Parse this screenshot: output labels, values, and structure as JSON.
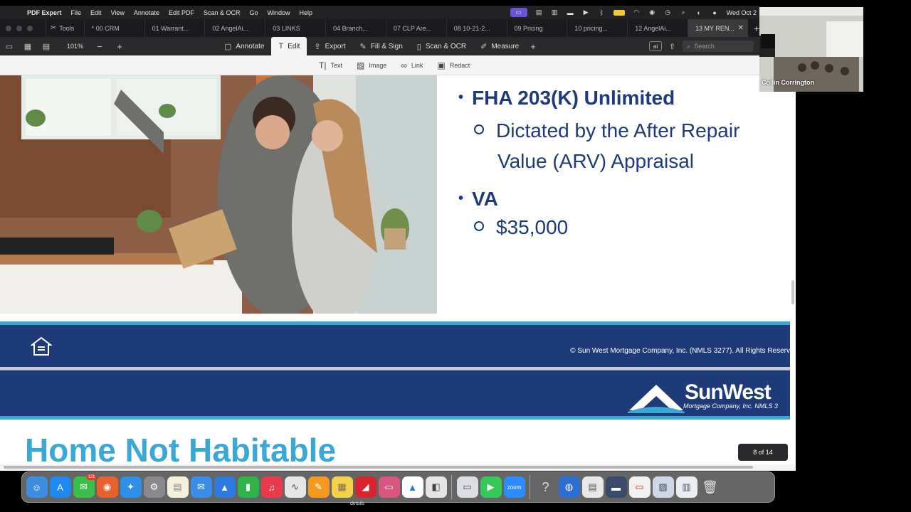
{
  "menubar": {
    "app_name": "PDF Expert",
    "menus": [
      "File",
      "Edit",
      "View",
      "Annotate",
      "Edit PDF",
      "Scan & OCR",
      "Go",
      "Window",
      "Help"
    ],
    "clock": "Wed Oct 2"
  },
  "tabs": {
    "tools_label": "Tools",
    "items": [
      "* 00 CRM",
      "01 Warrant...",
      "02 AngelAi...",
      "03 LINKS",
      "04 Branch...",
      "07 CLP Are...",
      "08 10-21-2...",
      "09 Pricing",
      "10 pricing...",
      "12 AngelAi...",
      "13 MY REN..."
    ],
    "active_index": 10
  },
  "toolbar": {
    "zoom": "101%",
    "modes": [
      "Annotate",
      "Edit",
      "Export",
      "Fill & Sign",
      "Scan & OCR",
      "Measure"
    ],
    "active_mode": "Edit",
    "ai_label": "ai",
    "search_placeholder": "Search"
  },
  "edit_tools": [
    "Text",
    "Image",
    "Link",
    "Redact"
  ],
  "document": {
    "bullet1": "FHA 203(K) Unlimited",
    "sub1_line1": "Dictated by the After Repair",
    "sub1_line2": "Value (ARV) Appraisal",
    "bullet2": "VA",
    "sub2": "$35,000",
    "copyright": "© Sun West Mortgage Company, Inc. (NMLS 3277). All Rights Reserv",
    "logo_main": "SunWest",
    "logo_sub": "Mortgage Company, Inc. NMLS 3",
    "heading": "Home Not Habitable",
    "page_indicator": "8 of 14"
  },
  "video": {
    "name": "Collin Corrington"
  },
  "dock": {
    "messages_badge": "121",
    "zoom_label": "zoom",
    "tooltip": "details"
  },
  "colors": {
    "brand_navy": "#1e3a78",
    "brand_cyan": "#3ba7d4"
  }
}
